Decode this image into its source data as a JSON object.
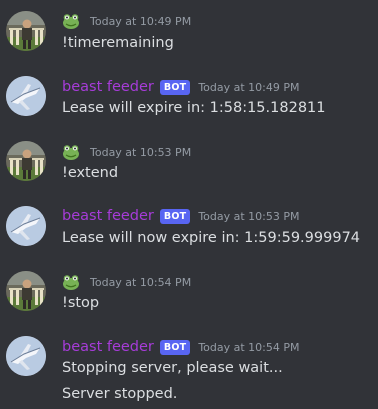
{
  "messages": [
    {
      "author_type": "user",
      "author_icon": "frog-emoji-icon",
      "timestamp": "Today at 10:49 PM",
      "lines": [
        "!timeremaining"
      ]
    },
    {
      "author_type": "bot",
      "author": "beast feeder",
      "bot_tag": "BOT",
      "timestamp": "Today at 10:49 PM",
      "lines": [
        "Lease will expire in: 1:58:15.182811"
      ]
    },
    {
      "author_type": "user",
      "author_icon": "frog-emoji-icon",
      "timestamp": "Today at 10:53 PM",
      "lines": [
        "!extend"
      ]
    },
    {
      "author_type": "bot",
      "author": "beast feeder",
      "bot_tag": "BOT",
      "timestamp": "Today at 10:53 PM",
      "lines": [
        "Lease will now expire in: 1:59:59.999974"
      ]
    },
    {
      "author_type": "user",
      "author_icon": "frog-emoji-icon",
      "timestamp": "Today at 10:54 PM",
      "lines": [
        "!stop"
      ]
    },
    {
      "author_type": "bot",
      "author": "beast feeder",
      "bot_tag": "BOT",
      "timestamp": "Today at 10:54 PM",
      "lines": [
        "Stopping server, please wait...",
        "Server stopped."
      ]
    }
  ],
  "colors": {
    "background": "#313338",
    "bot_name": "#a63cd8",
    "bot_tag": "#5865f2",
    "timestamp": "#949ba4",
    "text": "#dbdee1"
  }
}
